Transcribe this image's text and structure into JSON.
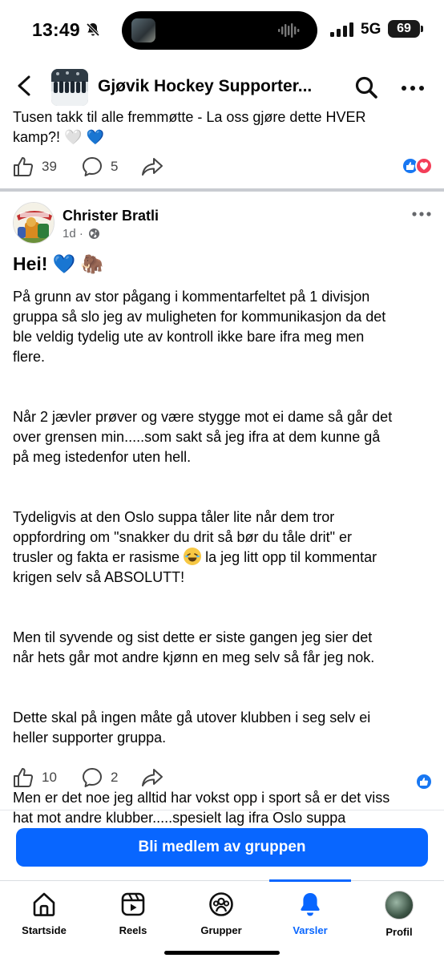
{
  "status_bar": {
    "time": "13:49",
    "network": "5G",
    "battery": "69",
    "icons": [
      "bell-muted-icon",
      "signal-bars-icon"
    ]
  },
  "header": {
    "title": "Gjøvik Hockey Supporter...",
    "icons": [
      "back-chevron-icon",
      "search-icon",
      "more-dots-icon"
    ]
  },
  "previous_post": {
    "text_line1": "Tusen takk til alle fremmøtte - La oss gjøre dette HVER",
    "text_line2": "kamp?! 🤍 💙",
    "likes": "39",
    "comments": "5"
  },
  "post": {
    "author": "Christer Bratli",
    "time": "1d ·",
    "heading": "Hei! 💙 🦣",
    "paragraphs": [
      "På grunn av stor pågang i kommentarfeltet på 1 divisjon\ngruppa så slo jeg av muligheten for kommunikasjon da det\nble veldig tydelig ute av kontroll ikke bare ifra meg men\nflere.",
      "Når 2 jævler prøver og være stygge mot ei dame så går det\nover grensen min.....som sakt så jeg ifra at dem kunne gå\npå meg istedenfor uten hell.",
      "Men til syvende og sist dette er siste gangen jeg sier det\nnår hets går mot andre kjønn en meg selv så får jeg nok.",
      "Dette skal på ingen måte gå utover klubben i seg selv ei\nheller supporter gruppa.",
      "Men er det noe jeg alltid har vokst opp i sport så er det viss\nhat mot andre klubber.....spesielt lag ifra Oslo suppa"
    ],
    "p3_before": "Tydeligvis at den Oslo suppa tåler lite når dem tror\noppfordring om \"snakker du drit så bør du tåle drit\" er\ntrusler og fakta er rasisme ",
    "p3_after": " la jeg litt opp til kommentar\nkrigen selv så ABSOLUTT!",
    "likes": "10",
    "comments": "2"
  },
  "join_button": "Bli medlem av gruppen",
  "tabs": [
    {
      "label": "Startside",
      "icon": "home-icon"
    },
    {
      "label": "Reels",
      "icon": "reels-icon"
    },
    {
      "label": "Grupper",
      "icon": "groups-icon"
    },
    {
      "label": "Varsler",
      "icon": "bell-icon",
      "active": true
    },
    {
      "label": "Profil",
      "icon": "profile-avatar"
    }
  ],
  "colors": {
    "accent": "#0866ff",
    "like": "#1877f2",
    "love": "#f33e58"
  }
}
